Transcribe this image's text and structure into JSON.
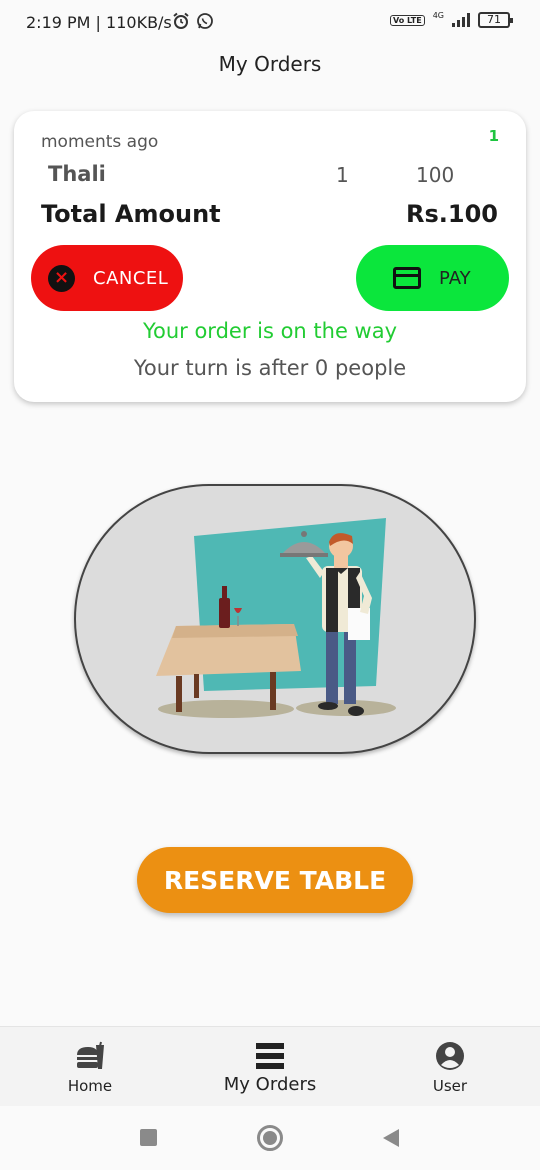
{
  "status_bar": {
    "time": "2:19 PM | 110KB/s",
    "network": "4G",
    "volte": "Vo LTE",
    "battery": "71"
  },
  "header": {
    "title": "My Orders"
  },
  "order": {
    "time": "moments ago",
    "count": "1",
    "item": {
      "name": "Thali",
      "qty": "1",
      "price": "100"
    },
    "total_label": "Total Amount",
    "total_value": "Rs.100",
    "cancel_label": "CANCEL",
    "pay_label": "PAY",
    "status_text": "Your order is on the way",
    "queue_text": "Your turn is after 0 people"
  },
  "reserve_button": {
    "label": "RESERVE TABLE"
  },
  "bottom_nav": {
    "items": [
      {
        "label": "Home",
        "icon": "fastfood-icon"
      },
      {
        "label": "My Orders",
        "icon": "orders-list-icon"
      },
      {
        "label": "User",
        "icon": "account-circle-icon"
      }
    ],
    "active": "My Orders"
  },
  "colors": {
    "cancel": "#ee1111",
    "pay": "#0be63c",
    "status_green": "#22cc33",
    "reserve": "#ec9012",
    "illustration_bg": "#dcdcdc"
  }
}
